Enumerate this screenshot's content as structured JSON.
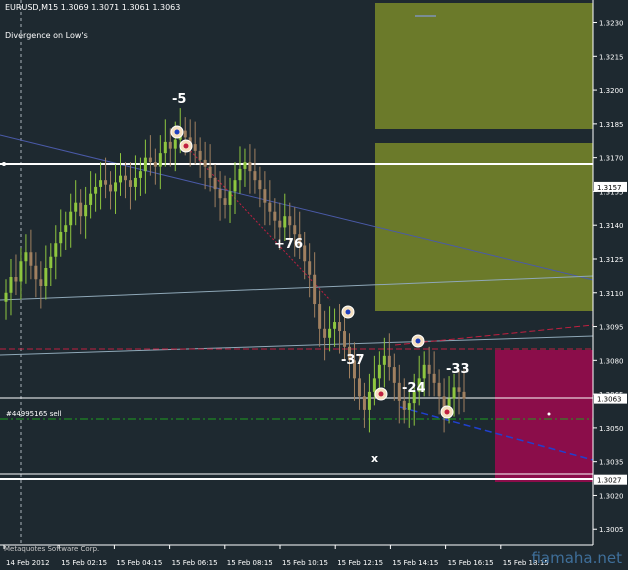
{
  "header": {
    "symbol_timeframe": "EURUSD,M15",
    "ohlc": "1.3069 1.3071 1.3061 1.3063",
    "indicator": "Divergence on Low's"
  },
  "order_label": "#44995165 sell",
  "copyright": "Metaquotes Software Corp.",
  "watermark": "fiamaha.net",
  "annotations": [
    "-5",
    "+76",
    "-37",
    "-24",
    "-33"
  ],
  "x_marker": "x",
  "colors": {
    "background": "#1e2930",
    "bull_candle": "#8ec63f",
    "bear_candle": "#a08060",
    "zone_olive": "#6b7a2a",
    "zone_maroon": "#8b0d4a",
    "hline_white": "#ffffff",
    "order_line": "#1fa01f",
    "trend_blue": "#4060c0",
    "trend_red": "#c02040"
  },
  "chart_data": {
    "type": "candlestick",
    "y_ticks": [
      "1.3230",
      "1.3215",
      "1.3200",
      "1.3185",
      "1.3170",
      "1.3155",
      "1.3140",
      "1.3125",
      "1.3110",
      "1.3095",
      "1.3080",
      "1.3065",
      "1.3050",
      "1.3035",
      "1.3020",
      "1.3005"
    ],
    "ylim": [
      1.2998,
      1.324
    ],
    "price_markers": [
      {
        "label": "1.3157",
        "price": 1.3157,
        "color": "#ffffff"
      },
      {
        "label": "1.3063",
        "price": 1.3063,
        "color": "#ffffff"
      },
      {
        "label": "1.3027",
        "price": 1.3027,
        "color": "#ffffff"
      }
    ],
    "x_ticks": [
      "14 Feb 2012",
      "15 Feb 02:15",
      "15 Feb 04:15",
      "15 Feb 06:15",
      "15 Feb 08:15",
      "15 Feb 10:15",
      "15 Feb 12:15",
      "15 Feb 14:15",
      "15 Feb 16:15",
      "15 Feb 18:15"
    ],
    "series": [
      {
        "name": "EURUSD",
        "close": [
          1.311,
          1.3117,
          1.3115,
          1.3124,
          1.3128,
          1.3122,
          1.3116,
          1.3113,
          1.3121,
          1.3126,
          1.3132,
          1.3137,
          1.314,
          1.3146,
          1.315,
          1.3144,
          1.3149,
          1.3154,
          1.3157,
          1.316,
          1.3158,
          1.3155,
          1.3159,
          1.3162,
          1.316,
          1.3157,
          1.3161,
          1.3164,
          1.317,
          1.3168,
          1.3166,
          1.3172,
          1.3177,
          1.3174,
          1.3178,
          1.3182,
          1.3179,
          1.3176,
          1.3173,
          1.3169,
          1.3166,
          1.3161,
          1.3156,
          1.3152,
          1.3149,
          1.3155,
          1.316,
          1.3165,
          1.3168,
          1.3164,
          1.316,
          1.3156,
          1.315,
          1.3146,
          1.3142,
          1.3139,
          1.3144,
          1.314,
          1.3136,
          1.3131,
          1.3124,
          1.3118,
          1.3105,
          1.3094,
          1.309,
          1.3094,
          1.3097,
          1.3093,
          1.3086,
          1.308,
          1.3072,
          1.3064,
          1.3058,
          1.3066,
          1.3072,
          1.3078,
          1.3082,
          1.3077,
          1.307,
          1.3062,
          1.3058,
          1.3061,
          1.3066,
          1.3072,
          1.3078,
          1.3074,
          1.307,
          1.3064,
          1.3058,
          1.3063,
          1.3068,
          1.3066,
          1.3063
        ]
      }
    ],
    "grid": false
  }
}
